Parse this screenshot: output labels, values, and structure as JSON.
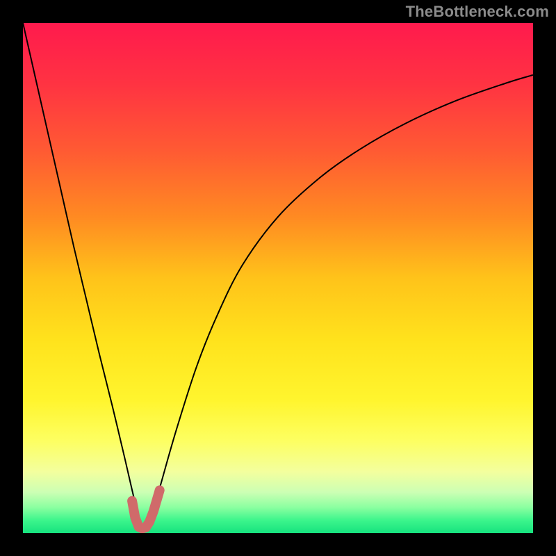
{
  "watermark": "TheBottleneck.com",
  "chart_data": {
    "type": "line",
    "title": "",
    "xlabel": "",
    "ylabel": "",
    "xlim": [
      0,
      100
    ],
    "ylim": [
      0,
      100
    ],
    "background": {
      "type": "vertical-gradient",
      "stops": [
        {
          "offset": 0.0,
          "color": "#ff1a4d"
        },
        {
          "offset": 0.12,
          "color": "#ff3342"
        },
        {
          "offset": 0.25,
          "color": "#ff5a33"
        },
        {
          "offset": 0.38,
          "color": "#ff8a22"
        },
        {
          "offset": 0.5,
          "color": "#ffc31a"
        },
        {
          "offset": 0.62,
          "color": "#ffe21c"
        },
        {
          "offset": 0.74,
          "color": "#fff52e"
        },
        {
          "offset": 0.82,
          "color": "#fdff62"
        },
        {
          "offset": 0.88,
          "color": "#f3ff9e"
        },
        {
          "offset": 0.92,
          "color": "#ccffb4"
        },
        {
          "offset": 0.95,
          "color": "#8affa0"
        },
        {
          "offset": 0.975,
          "color": "#3cf58c"
        },
        {
          "offset": 1.0,
          "color": "#16e27e"
        }
      ]
    },
    "series": [
      {
        "name": "bottleneck-curve",
        "color": "#000000",
        "stroke_width": 2,
        "x": [
          0.0,
          2.5,
          5.0,
          7.5,
          10.0,
          12.5,
          15.0,
          17.5,
          20.0,
          21.5,
          22.7,
          23.5,
          24.3,
          25.2,
          27.0,
          30.0,
          34.0,
          38.0,
          43.0,
          50.0,
          58.0,
          66.0,
          75.0,
          85.0,
          95.0,
          100.0
        ],
        "y": [
          100.0,
          89.0,
          78.0,
          67.0,
          56.0,
          45.5,
          35.0,
          25.0,
          14.5,
          8.0,
          3.2,
          1.0,
          1.0,
          3.0,
          9.5,
          20.0,
          32.5,
          42.5,
          52.5,
          62.0,
          69.5,
          75.2,
          80.3,
          84.8,
          88.3,
          89.8
        ]
      },
      {
        "name": "sweet-spot-marker",
        "color": "#d06a6a",
        "stroke_width": 14,
        "linecap": "round",
        "x": [
          21.4,
          22.0,
          22.7,
          23.4,
          24.1,
          24.8,
          25.6,
          26.8
        ],
        "y": [
          6.3,
          3.0,
          1.2,
          0.9,
          1.1,
          2.2,
          4.3,
          8.4
        ]
      }
    ]
  }
}
